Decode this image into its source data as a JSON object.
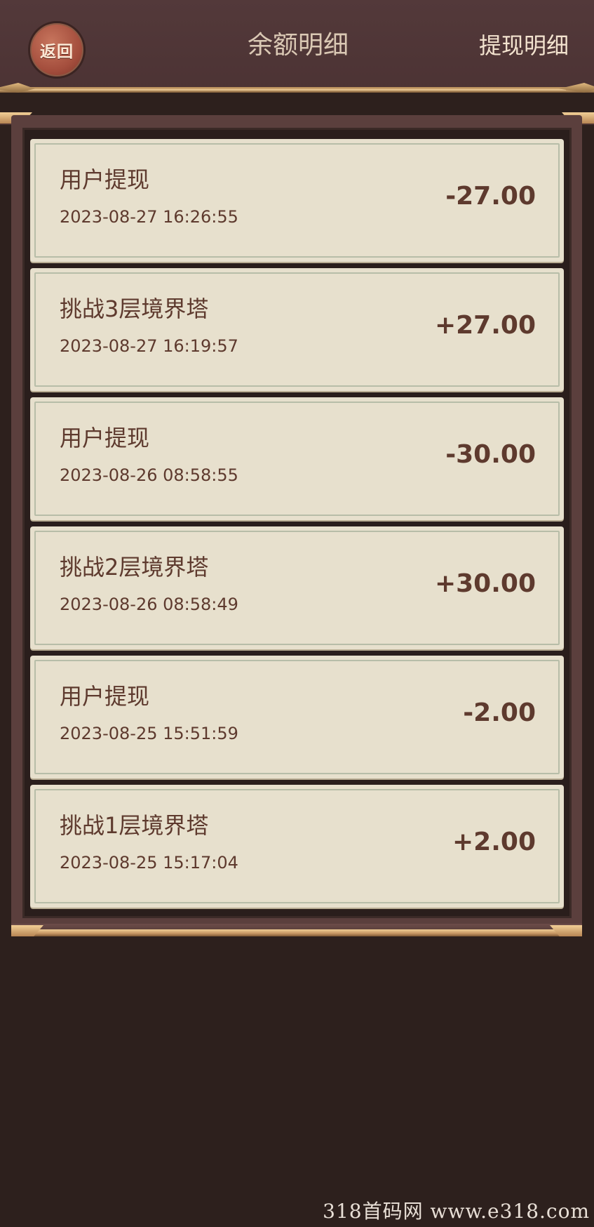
{
  "header": {
    "back_label": "返回",
    "title": "余额明细",
    "link_label": "提现明细"
  },
  "records": [
    {
      "title": "用户提现",
      "time": "2023-08-27 16:26:55",
      "amount": "-27.00"
    },
    {
      "title": "挑战3层境界塔",
      "time": "2023-08-27 16:19:57",
      "amount": "+27.00"
    },
    {
      "title": "用户提现",
      "time": "2023-08-26 08:58:55",
      "amount": "-30.00"
    },
    {
      "title": "挑战2层境界塔",
      "time": "2023-08-26 08:58:49",
      "amount": "+30.00"
    },
    {
      "title": "用户提现",
      "time": "2023-08-25 15:51:59",
      "amount": "-2.00"
    },
    {
      "title": "挑战1层境界塔",
      "time": "2023-08-25 15:17:04",
      "amount": "+2.00"
    }
  ],
  "watermark": "318首码网  www.e318.com",
  "colors": {
    "header_bg": "#4c3334",
    "page_bg": "#2d201d",
    "card_bg": "#e7e0cd",
    "text_brown": "#5e3a2e",
    "gold": "#d8b07a",
    "back_button": "#a44e3d"
  }
}
